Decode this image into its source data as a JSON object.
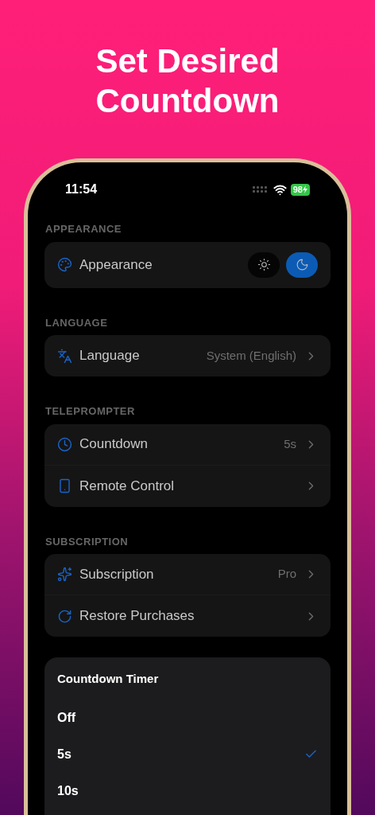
{
  "headline": "Set Desired Countdown",
  "status_bar": {
    "time": "11:54",
    "battery": "98"
  },
  "sections": [
    {
      "title": "APPEARANCE",
      "rows": [
        {
          "kind": "theme",
          "label": "Appearance",
          "modes": [
            {
              "selected": false
            },
            {
              "selected": true
            }
          ]
        }
      ]
    },
    {
      "title": "LANGUAGE",
      "rows": [
        {
          "kind": "link",
          "label": "Language",
          "value": "System (English)"
        }
      ]
    },
    {
      "title": "TELEPROMPTER",
      "rows": [
        {
          "kind": "link",
          "label": "Countdown",
          "value": "5s"
        },
        {
          "kind": "link",
          "label": "Remote Control"
        }
      ]
    },
    {
      "title": "SUBSCRIPTION",
      "rows": [
        {
          "kind": "link",
          "label": "Subscription",
          "value": "Pro"
        },
        {
          "kind": "link",
          "label": "Restore Purchases"
        }
      ]
    }
  ],
  "sheet": {
    "title": "Countdown Timer",
    "options": [
      {
        "label": "Off",
        "selected": false
      },
      {
        "label": "5s",
        "selected": true
      },
      {
        "label": "10s",
        "selected": false
      }
    ]
  }
}
